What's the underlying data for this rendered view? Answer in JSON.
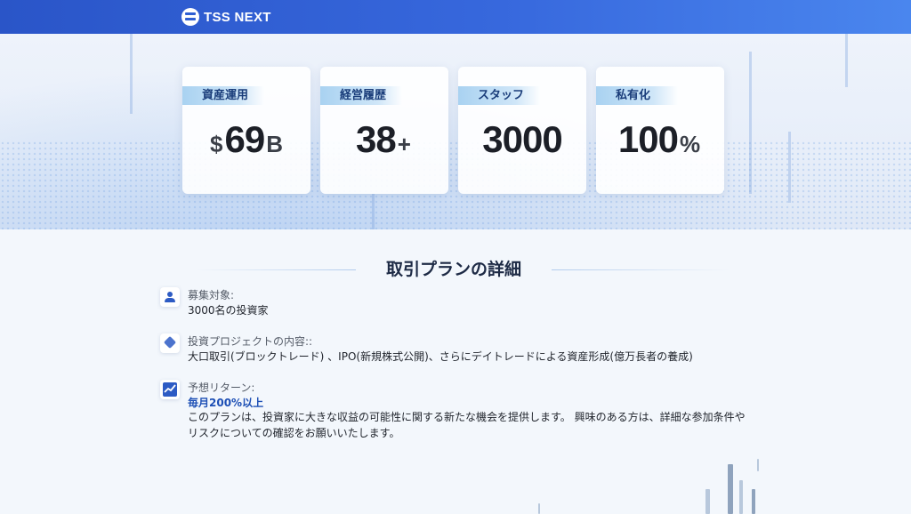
{
  "header": {
    "brand": "TSS NEXT"
  },
  "stats": [
    {
      "label": "資産運用",
      "prefix": "$",
      "value": "69",
      "suffix": "B"
    },
    {
      "label": "経営履歴",
      "prefix": "",
      "value": "38",
      "suffix": "+"
    },
    {
      "label": "スタッフ",
      "prefix": "",
      "value": "3000",
      "suffix": ""
    },
    {
      "label": "私有化",
      "prefix": "",
      "value": "100",
      "suffix": "%"
    }
  ],
  "section": {
    "title": "取引プランの詳細",
    "items": [
      {
        "icon": "person-icon",
        "heading": "募集対象:",
        "body": "3000名の投資家"
      },
      {
        "icon": "layers-icon",
        "heading": "投資プロジェクトの内容::",
        "body": "大口取引(ブロックトレード) 、IPO(新規株式公開)、さらにデイトレードによる資産形成(億万長者の養成)"
      },
      {
        "icon": "chart-icon",
        "heading": "予想リターン:",
        "highlight": "毎月200%以上",
        "body_line1": "このプランは、投資家に大きな収益の可能性に関する新たな機会を提供します。 興味のある方は、詳細な参加条件や",
        "body_line2": "リスクについての確認をお願いいたします。"
      }
    ]
  },
  "colors": {
    "header_start": "#2a55c8",
    "header_end": "#4a86ee",
    "accent_text": "#1d4fb5",
    "label_bg": "#a9d2f1"
  }
}
